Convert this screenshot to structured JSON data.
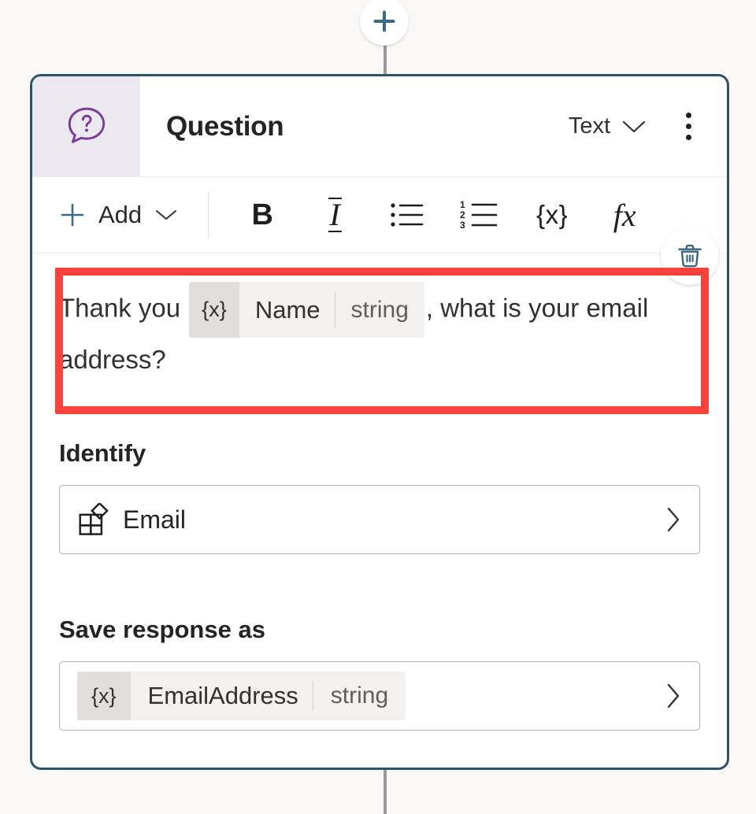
{
  "canvas": {
    "background_color": "#faf9f8",
    "add_node_button_label": "+",
    "connector_color": "#9a9a9a"
  },
  "node": {
    "border_color": "#2f5366",
    "icon_panel_color": "#ece8f0",
    "icon": "question-speech-bubble-icon",
    "title": "Question",
    "type_selector": {
      "value": "Text",
      "chevron": "chevron-down-icon"
    },
    "overflow_menu": "more-options-icon"
  },
  "toolbar": {
    "add_label": "Add",
    "add_icon": "plus-icon",
    "add_chevron": "chevron-down-icon",
    "buttons": [
      {
        "name": "bold",
        "glyph": "B"
      },
      {
        "name": "italic",
        "glyph": "I"
      },
      {
        "name": "bulleted-list",
        "glyph": "bulleted-list-icon"
      },
      {
        "name": "numbered-list",
        "glyph": "numbered-list-icon"
      },
      {
        "name": "variable",
        "glyph": "{x}"
      },
      {
        "name": "formula",
        "glyph": "fx"
      }
    ],
    "numbered_list_digits": [
      "1",
      "2",
      "3"
    ]
  },
  "prompt": {
    "text_before": "Thank you",
    "text_after": ", what is your email address?",
    "variable": {
      "prefix": "{x}",
      "name": "Name",
      "type": "string"
    },
    "delete_button": "delete-icon",
    "highlight_color": "#f9423a"
  },
  "identify": {
    "label": "Identify",
    "value": "Email",
    "icon": "entity-shapes-icon",
    "chevron": "chevron-right-icon"
  },
  "save_response": {
    "label": "Save response as",
    "variable": {
      "prefix": "{x}",
      "name": "EmailAddress",
      "type": "string"
    },
    "chevron": "chevron-right-icon"
  }
}
